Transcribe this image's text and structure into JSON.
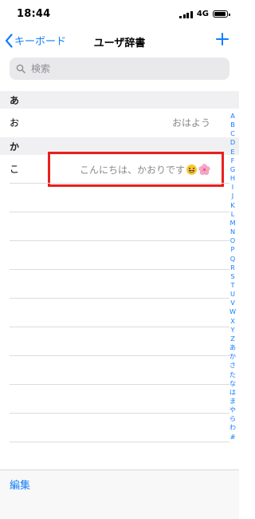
{
  "status_bar": {
    "time": "18:44",
    "network": "4G",
    "battery_level": 0.9
  },
  "nav": {
    "back_label": "キーボード",
    "title": "ユーザ辞書",
    "add_icon": "plus-icon"
  },
  "search": {
    "placeholder": "検索"
  },
  "sections": [
    {
      "header": "あ",
      "entries": [
        {
          "reading": "お",
          "word": "おはよう"
        }
      ]
    },
    {
      "header": "か",
      "entries": [
        {
          "reading": "こ",
          "word": "こんにちは、かおりです",
          "emoji": [
            "grinning-face",
            "cherry-blossom"
          ]
        }
      ]
    }
  ],
  "index": [
    "A",
    "B",
    "C",
    "D",
    "E",
    "F",
    "G",
    "H",
    "I",
    "J",
    "K",
    "L",
    "M",
    "N",
    "O",
    "P",
    "Q",
    "R",
    "S",
    "T",
    "U",
    "V",
    "W",
    "X",
    "Y",
    "Z",
    "あ",
    "か",
    "さ",
    "た",
    "な",
    "は",
    "ま",
    "や",
    "ら",
    "わ",
    "#"
  ],
  "toolbar": {
    "edit_label": "編集"
  },
  "colors": {
    "accent": "#147efb",
    "highlight": "#e8201c"
  }
}
